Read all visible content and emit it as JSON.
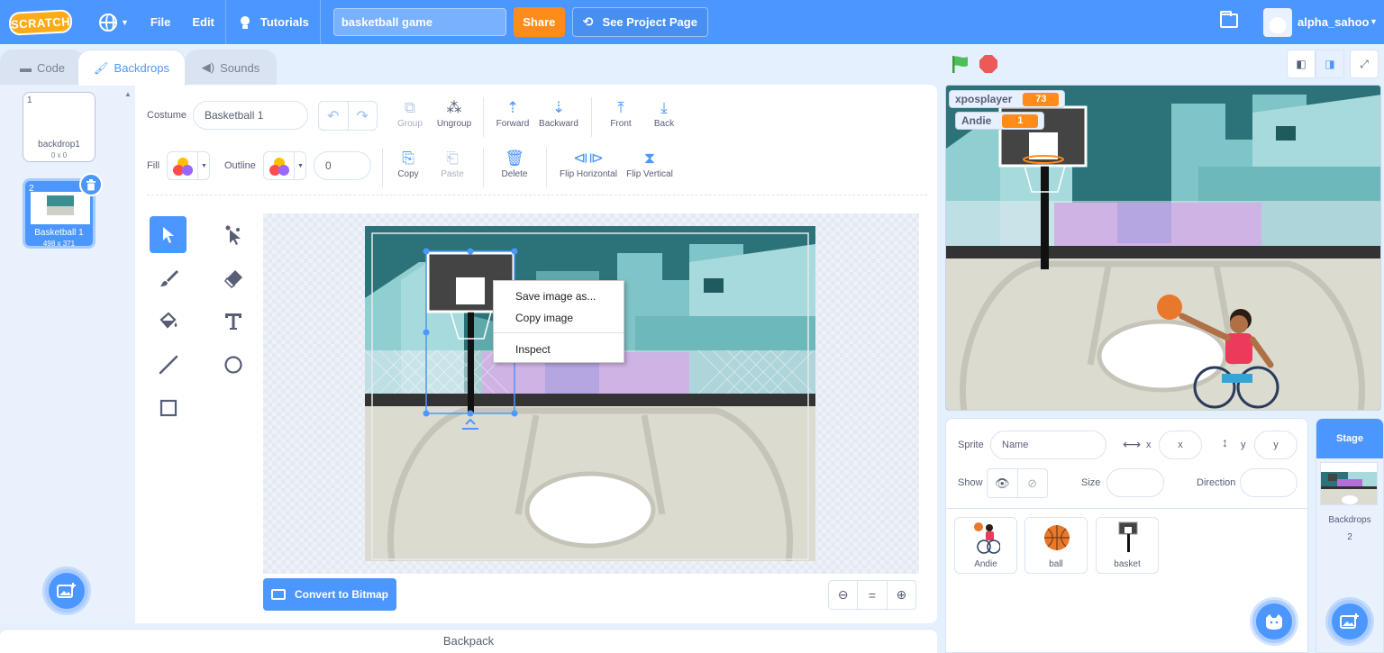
{
  "menubar": {
    "logo": "SCRATCH",
    "file": "File",
    "edit": "Edit",
    "tutorials": "Tutorials",
    "project_title": "basketball game",
    "share": "Share",
    "see_project": "See Project Page",
    "username": "alpha_sahoo"
  },
  "tabs": [
    {
      "label": "Code",
      "icon": "code-icon"
    },
    {
      "label": "Backdrops",
      "icon": "brush-icon",
      "active": true
    },
    {
      "label": "Sounds",
      "icon": "speaker-icon"
    }
  ],
  "backdrops": [
    {
      "num": "1",
      "name": "backdrop1",
      "size": "0 x 0"
    },
    {
      "num": "2",
      "name": "Basketball 1",
      "size": "498 x 371",
      "selected": true
    }
  ],
  "paint": {
    "costume_label": "Costume",
    "costume_name": "Basketball 1",
    "fill_label": "Fill",
    "outline_label": "Outline",
    "outline_width": "0",
    "tools_row1": [
      "Group",
      "Ungroup",
      "Forward",
      "Backward",
      "Front",
      "Back"
    ],
    "tools_row2": [
      "Copy",
      "Paste",
      "Delete",
      "Flip Horizontal",
      "Flip Vertical"
    ],
    "convert": "Convert to Bitmap",
    "zoom_reset": "="
  },
  "context_menu": [
    "Save image as...",
    "Copy image",
    "Inspect"
  ],
  "backpack": "Backpack",
  "monitors": [
    {
      "name": "xposplayer",
      "value": "73"
    },
    {
      "name": "Andie",
      "value": "1"
    }
  ],
  "sprite_info": {
    "sprite_label": "Sprite",
    "name_placeholder": "Name",
    "x_label": "x",
    "x_placeholder": "x",
    "y_label": "y",
    "y_placeholder": "y",
    "show_label": "Show",
    "size_label": "Size",
    "direction_label": "Direction"
  },
  "sprites": [
    {
      "name": "Andie"
    },
    {
      "name": "ball"
    },
    {
      "name": "basket"
    }
  ],
  "stage_pane": {
    "title": "Stage",
    "backdrops_label": "Backdrops",
    "backdrops_count": "2"
  },
  "colors": {
    "accent": "#4c97ff",
    "share": "#ff8c1a",
    "monitor_value": "#ff8c1a",
    "stop": "#ec5959",
    "flag": "#4cbf56"
  }
}
